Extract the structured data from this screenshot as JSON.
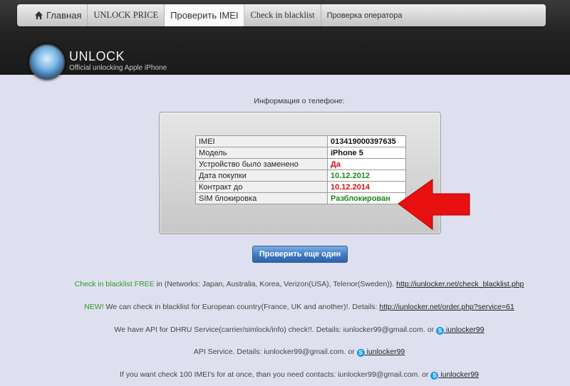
{
  "nav": {
    "items": [
      {
        "label": "Главная"
      },
      {
        "label": "UNLOCK PRICE"
      },
      {
        "label": "Проверить IMEI"
      },
      {
        "label": "Check in blacklist"
      },
      {
        "label": "Проверка оператора"
      }
    ]
  },
  "logo": {
    "title": "UNLOCK",
    "subtitle": "Official unlocking Apple iPhone"
  },
  "info": {
    "heading": "Информация о телефоне:",
    "rows": [
      {
        "key": "IMEI",
        "value": "013419000397635",
        "color": "#111111"
      },
      {
        "key": "Модель",
        "value": "iPhone 5",
        "color": "#111111"
      },
      {
        "key": "Устройство было заменено",
        "value": "Да",
        "color": "#d01010"
      },
      {
        "key": "Дата покупки",
        "value": "10.12.2012",
        "color": "#1a8a1a"
      },
      {
        "key": "Контракт до",
        "value": "10.12.2014",
        "color": "#d01010"
      },
      {
        "key": "SIM блокировка",
        "value": "Разблокирован",
        "color": "#1a8a1a"
      }
    ]
  },
  "check_again_button": "Проверить еще один",
  "lines": {
    "l1_green": "Check in blacklist FREE",
    "l1_text": " in (Networks: Japan, Australia, Korea, Verizon(USA), Telenor(Sweden)). ",
    "l1_link": "http://iunlocker.net/check_blacklist.php",
    "l2_green": "NEW!",
    "l2_text": " We can check in blacklist for European country(France, UK and another)!. Details: ",
    "l2_link": "http://iunlocker.net/order.php?service=61",
    "l3_text": "We have API for DHRU Service(carrier/simlock/info) check!!. Details: iunlocker99@gmail.com. or ",
    "l3_skype": " iunlocker99",
    "l4_text": "API Service. Details: iunlocker99@gmail.com. or ",
    "l4_skype": " iunlocker99",
    "l5_text": "If you want check 100 IMEI's for at once, than you need contacts: iunlocker99@gmail.com. or ",
    "l5_skype": " iunlocker99"
  },
  "colors": {
    "accent_green": "#2c9a2c",
    "arrow_red": "#e81010",
    "button_blue": "#3d78c2"
  },
  "icons": [
    "home-icon",
    "skype-icon",
    "red-arrow-icon",
    "logo-icon"
  ]
}
